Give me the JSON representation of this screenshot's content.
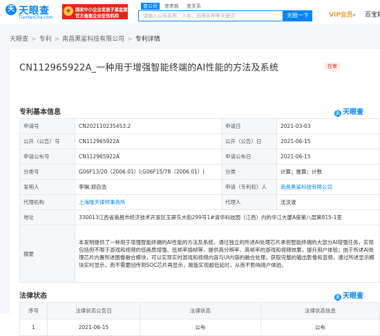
{
  "header": {
    "logo": {
      "mark": "天",
      "name": "天眼查",
      "domain": "TianYanCha.com"
    },
    "gov_badge": {
      "line1": "国家中小企业发展子基金旗下",
      "line2": "官方备案企业征信机构"
    },
    "search_tabs": [
      "查公司",
      "查老板",
      "查关系"
    ],
    "search_placeholder": "请输入公司名称、人名、品牌名称等关键词",
    "search_button": "天眼一下",
    "vip_label": "VIP会员",
    "vip_caret": "▾",
    "extra_link": "百宝箱"
  },
  "breadcrumb": [
    "天眼查",
    "专利",
    "南昌黑鲨科技有限公司",
    "专利详情"
  ],
  "breadcrumb_sep": ">",
  "patent": {
    "title": "CN112965922A_一种用于增强智能终端的AI性能的方法及系统",
    "status": "在审"
  },
  "basic_info": {
    "heading": "专利基本信息",
    "watermark": "天眼查",
    "rows": [
      {
        "l1": "申请号",
        "v1": "CN202110235453.2",
        "l2": "申请日",
        "v2": "2021-03-03"
      },
      {
        "l1": "公开（公告）号",
        "v1": "CN112965922A",
        "l2": "公开（公告）日",
        "v2": "2021-06-15"
      },
      {
        "l1": "申请公布号",
        "v1": "CN112965922A",
        "l2": "申请公布日",
        "v2": "2021-06-15"
      },
      {
        "l1": "分类号",
        "v1": "G06F13/20（2006.01）I;G06F15/78（2006.01）I",
        "l2": "分类",
        "v2": "计算；推算；计数"
      },
      {
        "l1": "发明人",
        "v1": "李琳;郑自浩",
        "l2": "申请（专利权）人",
        "v2": "南昌黑鲨科技有限公司"
      },
      {
        "l1": "代理机构",
        "v1": "上海隆天律师事务所",
        "l2": "代理人",
        "v2": "沈汶波"
      }
    ],
    "address_label": "地址",
    "address": "330013江西省南昌市经济技术开发区玉屏东大街299号1#清华科技园（江西）内的华江大厦A座第八层第815-1室",
    "abstract_label": "摘要",
    "abstract": "本发明提供了一种用于增强智能终端的AI性能的方法及系统，通过独立的所述AI处理芯片承担智能终端的大部分AI增强任务，实现包括但不限于游戏和视频的低画质增强、低帧率插帧等，提供高分辨率、高帧率的游戏和视频效果，提升用户体验；由于所述AI处理芯片内置所述图像融合模块，可以实现实时游戏和视频内容与UI内容的融合处理，获取完整的输出影像和音频，通过所述显示模块实时显示，而不需要回传到SOC芯片再显示，故能实现超低延时，从而不影响用户体验。"
  },
  "legal_status": {
    "heading": "法律状态",
    "watermark": "天眼查",
    "columns": [
      "序号",
      "法律状态公告日",
      "法律状态",
      "法律状态信息"
    ],
    "rows": [
      {
        "index": "1",
        "date": "2021-06-15",
        "status": "公布",
        "info": "公布"
      }
    ]
  }
}
